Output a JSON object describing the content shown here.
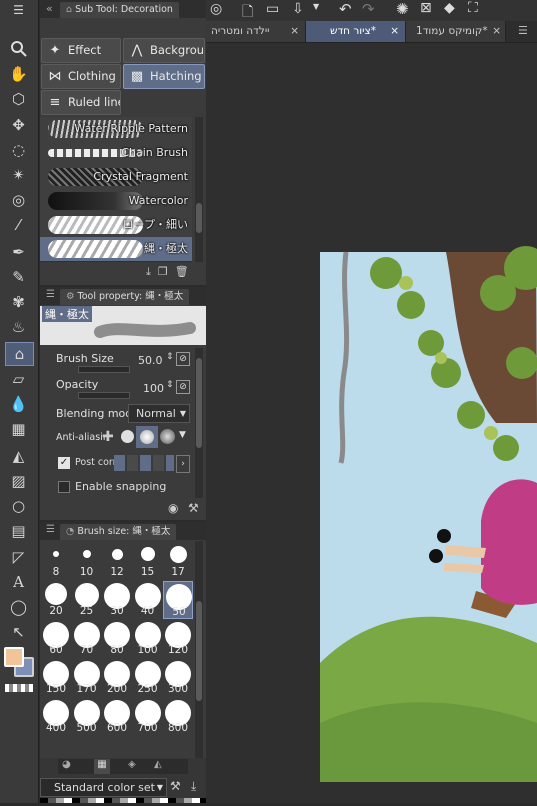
{
  "top_tabs": [
    {
      "label": "×",
      "title": "יילדה ומטריה"
    },
    {
      "label": "×",
      "title": "ציור חדש*"
    },
    {
      "label": "×",
      "title": "קומיקס עמוד1*"
    }
  ],
  "subtool_panel": {
    "title": "Sub Tool: Decoration",
    "categories": [
      {
        "label": "Effect"
      },
      {
        "label": "Backgroun"
      },
      {
        "label": "Clothing"
      },
      {
        "label": "Hatching a"
      },
      {
        "label": "Ruled line"
      }
    ],
    "brushes": [
      {
        "label": "Water Ripple Pattern"
      },
      {
        "label": "Chain Brush"
      },
      {
        "label": "Crystal Fragment"
      },
      {
        "label": "Watercolor"
      },
      {
        "label": "ロープ・細い"
      },
      {
        "label": "縄・極太"
      }
    ]
  },
  "tool_property": {
    "title": "Tool property: 縄・極太",
    "preview_label": "縄・極太",
    "brush_size_label": "Brush Size",
    "brush_size_value": "50.0",
    "opacity_label": "Opacity",
    "opacity_value": "100",
    "blending_label": "Blending mode",
    "blending_value": "Normal",
    "antialias_label": "Anti-aliasin",
    "post_correction_label": "Post corr",
    "snapping_label": "Enable snapping"
  },
  "brush_size_panel": {
    "title": "Brush size: 縄・極太",
    "sizes": [
      "8",
      "10",
      "12",
      "15",
      "17",
      "20",
      "25",
      "30",
      "40",
      "50",
      "60",
      "70",
      "80",
      "100",
      "120",
      "150",
      "170",
      "200",
      "250",
      "300",
      "400",
      "500",
      "600",
      "700",
      "800"
    ],
    "selected": "50"
  },
  "color_set": {
    "value": "Standard color set"
  },
  "colors": {
    "main": "#f2c49a",
    "sub": "#7d8fb8",
    "accent": "#5f6d88"
  }
}
